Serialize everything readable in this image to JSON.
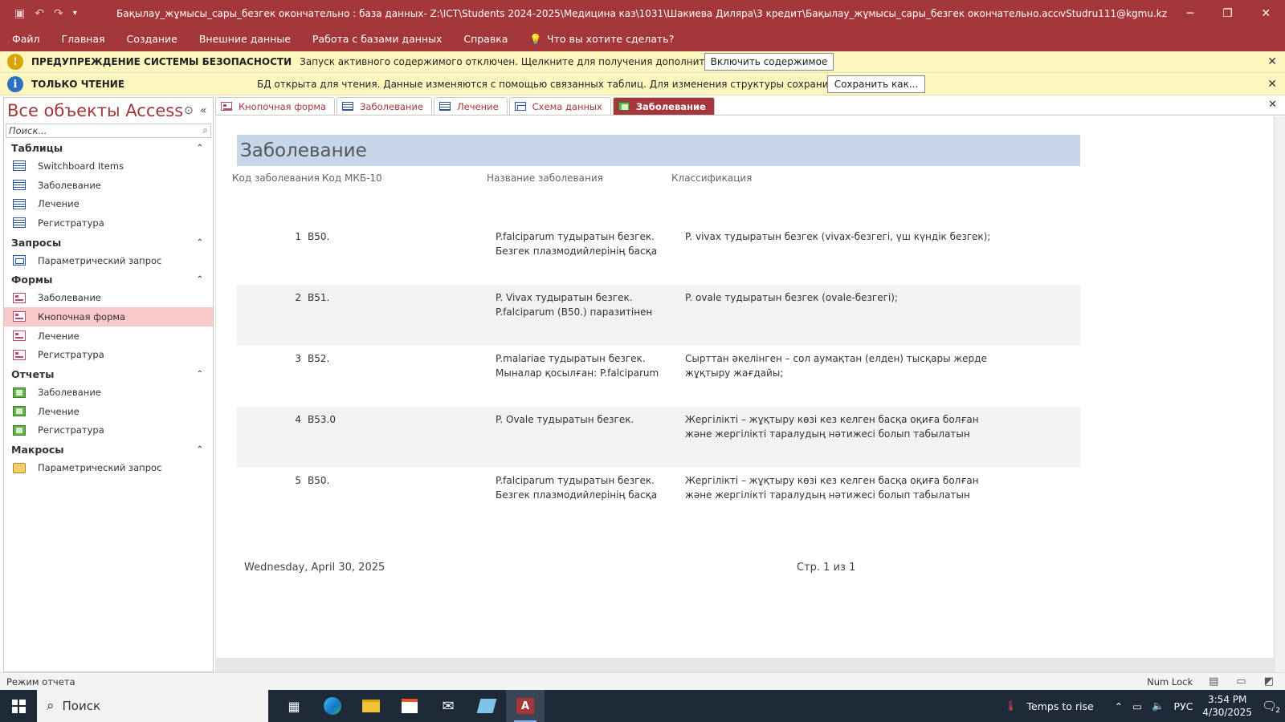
{
  "titlebar": {
    "title": "Бақылау_жұмысы_сары_безгек окончательно : база данных- Z:\\ICT\\Students 2024-2025\\Медицина каз\\1031\\Шакиева Диляра\\3 кредит\\Бақылау_жұмысы_сары_безгек окончательно.accdb (Формат файлов Acces...",
    "user": "vStudru111@kgmu.kz"
  },
  "menu": {
    "items": [
      "Файл",
      "Главная",
      "Создание",
      "Внешние данные",
      "Работа с базами данных",
      "Справка"
    ],
    "tell_me": "Что вы хотите сделать?"
  },
  "security_bar": {
    "title": "ПРЕДУПРЕЖДЕНИЕ СИСТЕМЫ БЕЗОПАСНОСТИ",
    "text": "Запуск активного содержимого отключен. Щелкните для получения дополнительных сведений.",
    "button": "Включить содержимое"
  },
  "readonly_bar": {
    "title": "ТОЛЬКО ЧТЕНИЕ",
    "text": "БД открыта для чтения. Данные изменяются с помощью связанных таблиц. Для изменения структуры сохраните копию БД.",
    "button": "Сохранить как..."
  },
  "nav": {
    "title": "Все объекты Access",
    "search_placeholder": "Поиск...",
    "groups": [
      {
        "label": "Таблицы",
        "items": [
          "Switchboard Items",
          "Заболевание",
          "Лечение",
          "Регистратура"
        ]
      },
      {
        "label": "Запросы",
        "items": [
          "Параметрический запрос"
        ]
      },
      {
        "label": "Формы",
        "items": [
          "Заболевание",
          "Кнопочная форма",
          "Лечение",
          "Регистратура"
        ]
      },
      {
        "label": "Отчеты",
        "items": [
          "Заболевание",
          "Лечение",
          "Регистратура"
        ]
      },
      {
        "label": "Макросы",
        "items": [
          "Параметрический запрос"
        ]
      }
    ]
  },
  "tabs": [
    "Кнопочная форма",
    "Заболевание",
    "Лечение",
    "Схема данных",
    "Заболевание"
  ],
  "report": {
    "title": "Заболевание",
    "headers": [
      "Код заболевания",
      "Код МКБ-10",
      "Название заболевания",
      "Классификация"
    ],
    "rows": [
      {
        "id": "1",
        "mkb": "B50.",
        "name": " P.falciparum тудыратын безгек. Безгек плазмодийлерінің басқа",
        "cls": "P. vivax тудыратын безгек (vivax-безгегі, үш күндік безгек);"
      },
      {
        "id": "2",
        "mkb": "B51.",
        "name": "P. Vivax тудыратын безгек. P.falciparum (B50.) паразитінен",
        "cls": "P. ovale тудыратын безгек (ovale-безгегі);"
      },
      {
        "id": "3",
        "mkb": "B52.",
        "name": "P.malariae тудыратын безгек. Мыналар қосылған: P.falciparum",
        "cls": "Сырттан әкелінген – сол аумақтан (елден) тысқары жерде жұқтыру жағдайы;"
      },
      {
        "id": "4",
        "mkb": "B53.0",
        "name": "P. Ovale тудыратын безгек.",
        "cls": "Жергілікті – жұқтыру көзі кез келген басқа оқиға болған және жергілікті таралудың  нәтижесі болып табылатын"
      },
      {
        "id": "5",
        "mkb": "B50.",
        "name": " P.falciparum тудыратын безгек. Безгек плазмодийлерінің басқа",
        "cls": "Жергілікті – жұқтыру көзі кез келген басқа оқиға болған және жергілікті таралудың  нәтижесі болып табылатын"
      }
    ],
    "date": "Wednesday, April 30, 2025",
    "page": "Стр. 1 из 1"
  },
  "status": {
    "mode": "Режим отчета",
    "numlock": "Num Lock"
  },
  "taskbar": {
    "search": "Поиск",
    "weather": "Temps to rise",
    "lang": "РУС",
    "time": "3:54 PM",
    "date": "4/30/2025",
    "notif_count": "2"
  },
  "colors": {
    "accent": "#a4373a",
    "message_bar": "#fdf6bf",
    "report_title_bg": "#c6d5ea",
    "selected_nav": "#f8c9cb"
  }
}
